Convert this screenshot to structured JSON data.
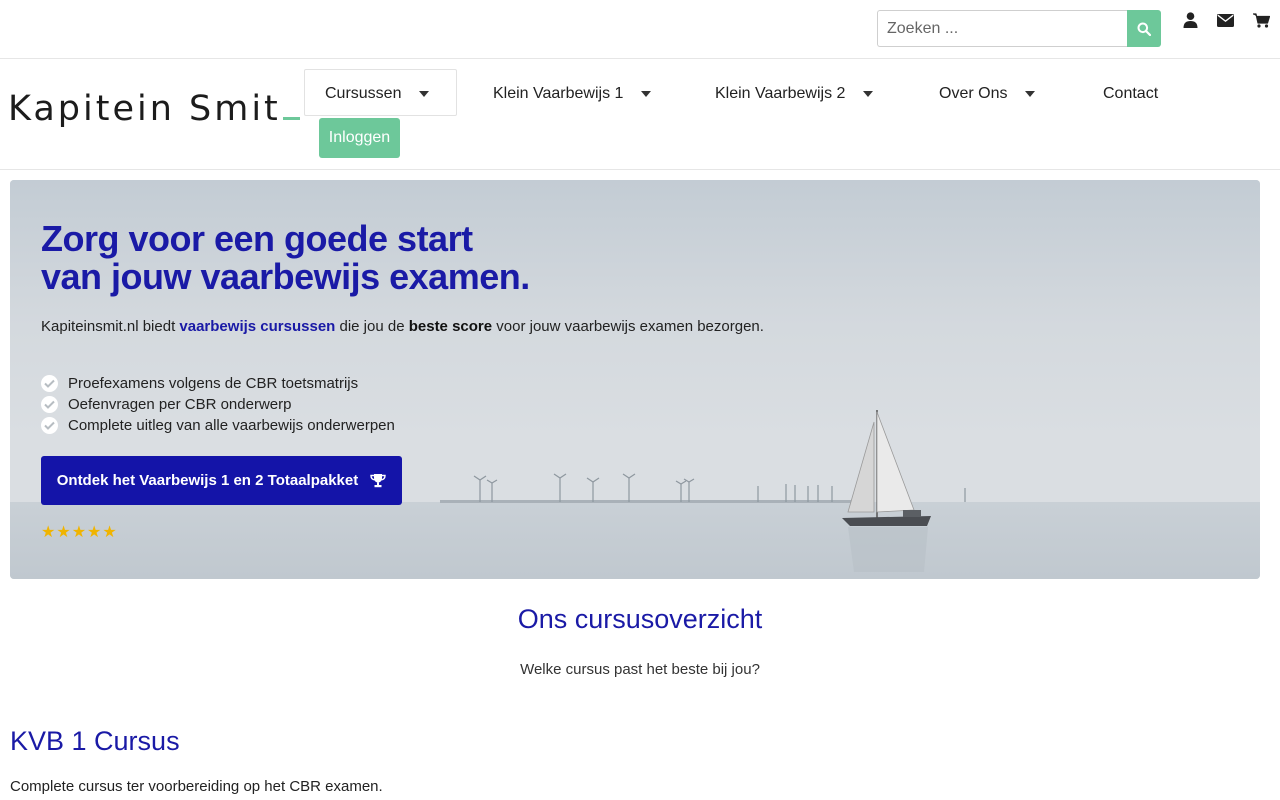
{
  "topbar": {
    "search_placeholder": "Zoeken ...",
    "icons": [
      "search-icon",
      "user-icon",
      "envelope-icon",
      "cart-icon"
    ],
    "accent_color": "#6dc89a"
  },
  "header": {
    "logo": {
      "text": "Kapitein Smit"
    },
    "nav": [
      {
        "label": "Cursussen",
        "has_dropdown": true
      },
      {
        "label": "Klein Vaarbewijs 1",
        "has_dropdown": true
      },
      {
        "label": "Klein Vaarbewijs 2",
        "has_dropdown": true
      },
      {
        "label": "Over Ons",
        "has_dropdown": true
      },
      {
        "label": "Contact",
        "has_dropdown": false
      }
    ],
    "login_label": "Inloggen"
  },
  "hero": {
    "title_line1": "Zorg voor een goede start",
    "title_line2": "van jouw vaarbewijs examen.",
    "intro_pre": "Kapiteinsmit.nl biedt ",
    "intro_link": "vaarbewijs cursussen",
    "intro_mid": " die jou de ",
    "intro_bold": "beste score",
    "intro_post": " voor jouw vaarbewijs examen bezorgen.",
    "checklist": [
      "Proefexamens volgens de CBR toetsmatrijs",
      "Oefenvragen per CBR onderwerp",
      "Complete uitleg van alle vaarbewijs onderwerpen"
    ],
    "cta_label": "Ontdek het Vaarbewijs 1 en 2 Totaalpakket",
    "cta_icon": "trophy-icon",
    "rating": 5,
    "title_color": "#1a1aa6",
    "cta_color": "#1414a8"
  },
  "overview": {
    "title": "Ons cursusoverzicht",
    "subtitle": "Welke cursus past het beste bij jou?"
  },
  "course": {
    "title": "KVB 1 Cursus",
    "description": "Complete cursus ter voorbereiding op het CBR examen."
  }
}
